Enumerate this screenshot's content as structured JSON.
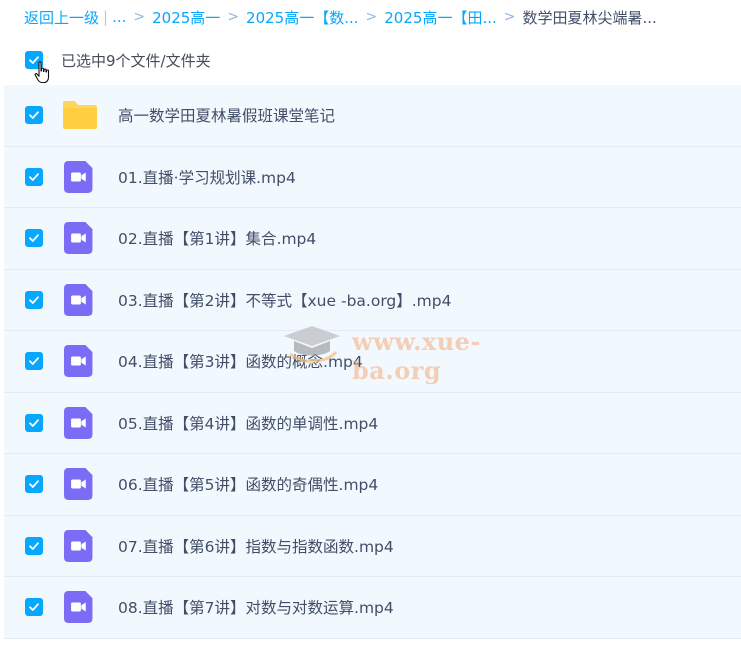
{
  "breadcrumb": {
    "back_label": "返回上一级",
    "ellipsis_label": "...",
    "items": [
      {
        "label": "2025高一"
      },
      {
        "label": "2025高一【数..."
      },
      {
        "label": "2025高一【田..."
      }
    ],
    "current": "数学田夏林尖端暑..."
  },
  "selection": {
    "text": "已选中9个文件/文件夹",
    "all_checked": true
  },
  "files": [
    {
      "type": "folder-icon",
      "name": "高一数学田夏林暑假班课堂笔记",
      "checked": true
    },
    {
      "type": "video-icon",
      "name": "01.直播·学习规划课.mp4",
      "checked": true
    },
    {
      "type": "video-icon",
      "name": "02.直播【第1讲】集合.mp4",
      "checked": true
    },
    {
      "type": "video-icon",
      "name": "03.直播【第2讲】不等式【xue -ba.org】.mp4",
      "checked": true
    },
    {
      "type": "video-icon",
      "name": "04.直播【第3讲】函数的概念.mp4",
      "checked": true
    },
    {
      "type": "video-icon",
      "name": "05.直播【第4讲】函数的单调性.mp4",
      "checked": true
    },
    {
      "type": "video-icon",
      "name": "06.直播【第5讲】函数的奇偶性.mp4",
      "checked": true
    },
    {
      "type": "video-icon",
      "name": "07.直播【第6讲】指数与指数函数.mp4",
      "checked": true
    },
    {
      "type": "video-icon",
      "name": "08.直播【第7讲】对数与对数运算.mp4",
      "checked": true
    }
  ],
  "watermark": {
    "text": "www.xue-ba.org"
  },
  "colors": {
    "accent": "#06a7ff",
    "row_background": "#f2f9fe",
    "folder": "#ffd659",
    "video": "#7b6cf5"
  }
}
